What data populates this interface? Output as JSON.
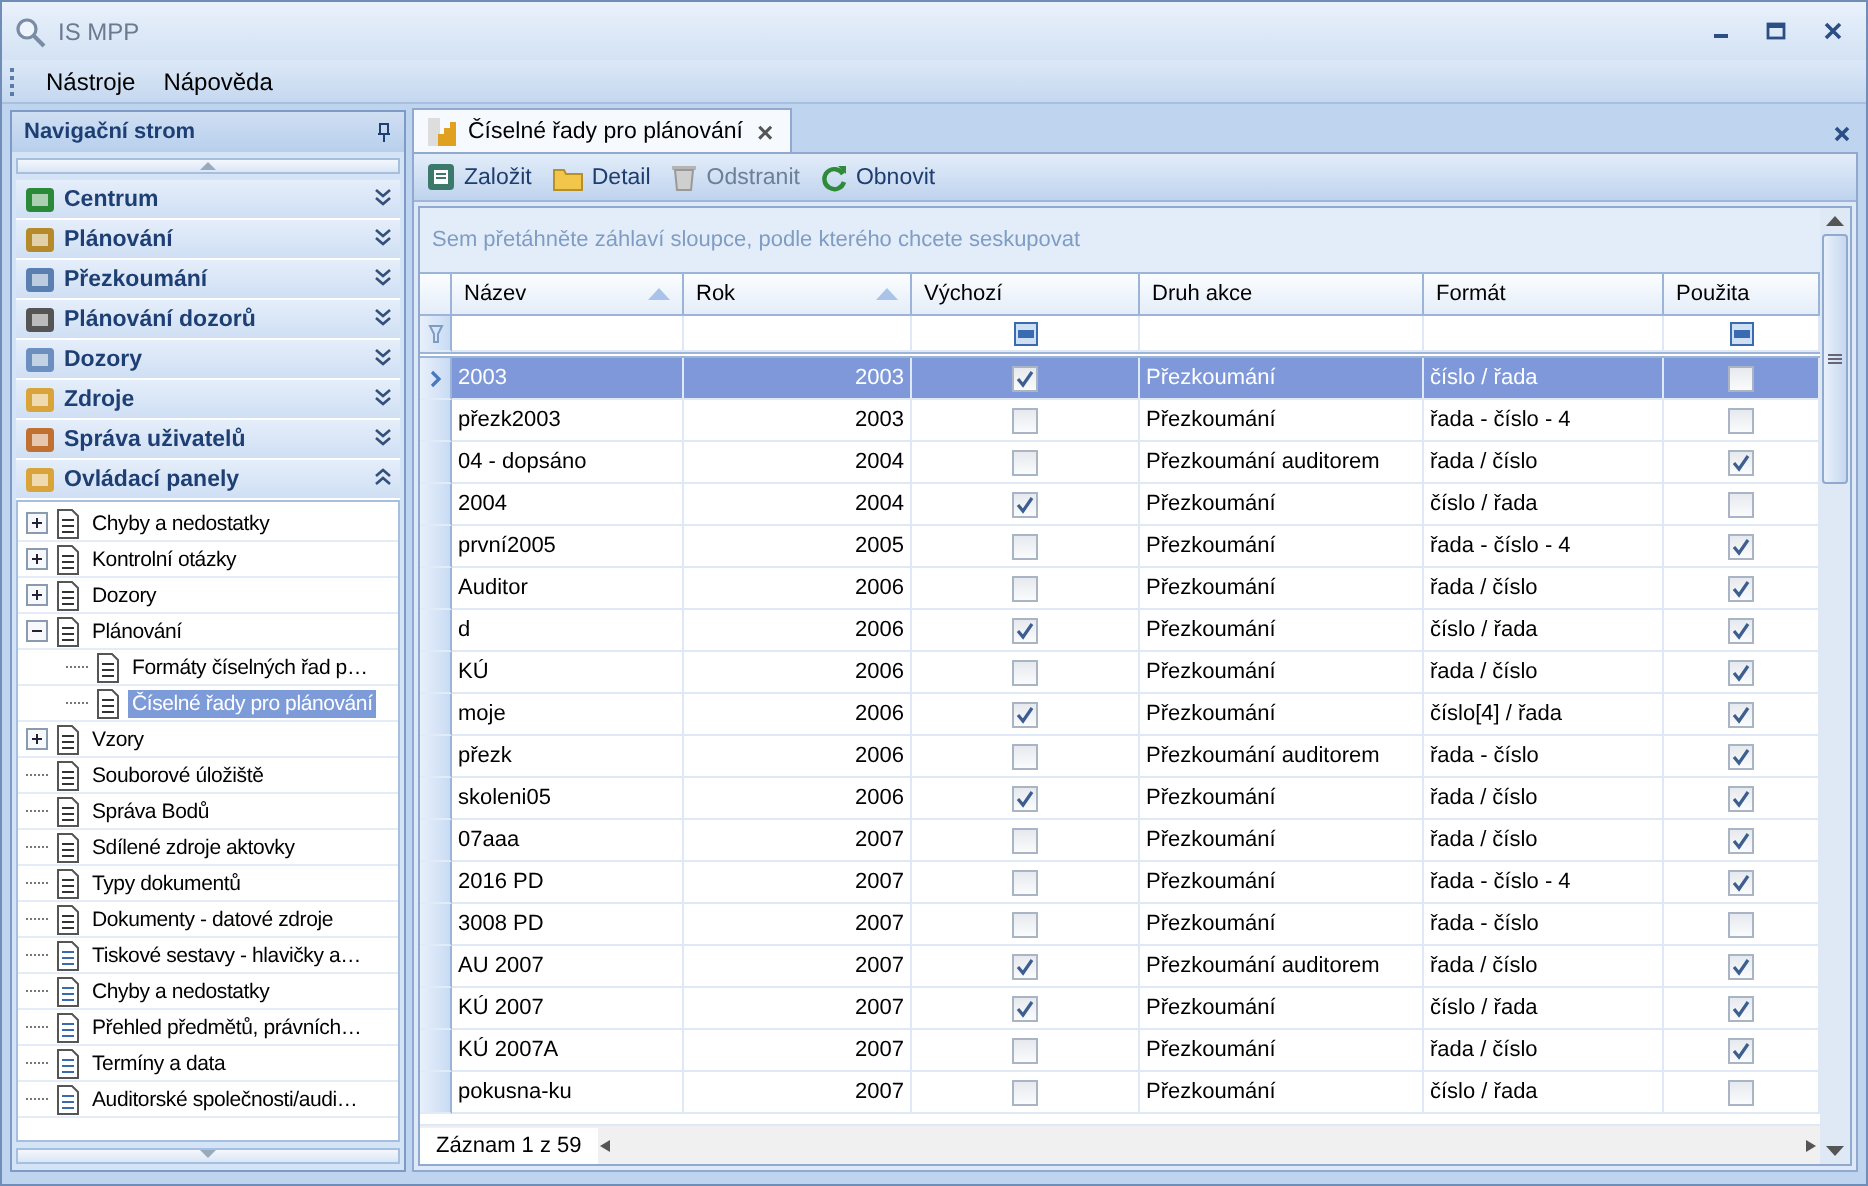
{
  "window": {
    "title": "IS MPP"
  },
  "menu": [
    "Nástroje",
    "Nápověda"
  ],
  "navigation": {
    "title": "Navigační strom",
    "groups": [
      {
        "label": "Centrum",
        "expanded": false
      },
      {
        "label": "Plánování",
        "expanded": false
      },
      {
        "label": "Přezkoumání",
        "expanded": false
      },
      {
        "label": "Plánování dozorů",
        "expanded": false
      },
      {
        "label": "Dozory",
        "expanded": false
      },
      {
        "label": "Zdroje",
        "expanded": false
      },
      {
        "label": "Správa uživatelů",
        "expanded": false
      },
      {
        "label": "Ovládací panely",
        "expanded": true
      }
    ],
    "tree": [
      {
        "label": "Chyby a nedostatky",
        "expanded": false,
        "selected": false
      },
      {
        "label": "Kontrolní otázky",
        "expanded": false,
        "selected": false
      },
      {
        "label": "Dozory",
        "expanded": false,
        "selected": false
      },
      {
        "label": "Plánování",
        "expanded": true,
        "selected": false,
        "children": [
          {
            "label": "Formáty číselných řad p…",
            "selected": false
          },
          {
            "label": "Číselné řady pro plánování",
            "selected": true
          }
        ]
      },
      {
        "label": "Vzory",
        "expanded": false,
        "selected": false
      },
      {
        "label": "Souborové úložiště",
        "selected": false
      },
      {
        "label": "Správa Bodů",
        "selected": false
      },
      {
        "label": "Sdílené zdroje aktovky",
        "selected": false
      },
      {
        "label": "Typy dokumentů",
        "selected": false
      },
      {
        "label": "Dokumenty - datové zdroje",
        "selected": false
      },
      {
        "label": "Tiskové sestavy - hlavičky a…",
        "selected": false
      },
      {
        "label": "Chyby a nedostatky",
        "selected": false
      },
      {
        "label": "Přehled předmětů, právních…",
        "selected": false
      },
      {
        "label": "Termíny a data",
        "selected": false
      },
      {
        "label": "Auditorské společnosti/audi…",
        "selected": false
      }
    ]
  },
  "document_tab": {
    "title": "Číselné řady pro plánování",
    "close": "×"
  },
  "toolbar": [
    {
      "label": "Založit",
      "disabled": false
    },
    {
      "label": "Detail",
      "disabled": false
    },
    {
      "label": "Odstranit",
      "disabled": true
    },
    {
      "label": "Obnovit",
      "disabled": false
    }
  ],
  "group_hint": "Sem přetáhněte záhlaví sloupce, podle kterého chcete seskupovat",
  "table": {
    "columns": [
      {
        "label": "Název",
        "sorted": true
      },
      {
        "label": "Rok",
        "sorted": true
      },
      {
        "label": "Výchozí",
        "sorted": false,
        "filter_indeterminate": true
      },
      {
        "label": "Druh akce",
        "sorted": false
      },
      {
        "label": "Formát",
        "sorted": false
      },
      {
        "label": "Použita",
        "sorted": false,
        "filter_indeterminate": true
      }
    ],
    "rows": [
      {
        "name": "2003",
        "year": "2003",
        "default": true,
        "action": "Přezkoumání",
        "format": "číslo / řada",
        "used": false,
        "selected": true
      },
      {
        "name": "přezk2003",
        "year": "2003",
        "default": false,
        "action": "Přezkoumání",
        "format": "řada - číslo - 4",
        "used": false,
        "selected": false
      },
      {
        "name": "04 - dopsáno",
        "year": "2004",
        "default": false,
        "action": "Přezkoumání auditorem",
        "format": "řada / číslo",
        "used": true,
        "selected": false
      },
      {
        "name": "2004",
        "year": "2004",
        "default": true,
        "action": "Přezkoumání",
        "format": "číslo / řada",
        "used": false,
        "selected": false
      },
      {
        "name": "první2005",
        "year": "2005",
        "default": false,
        "action": "Přezkoumání",
        "format": "řada - číslo - 4",
        "used": true,
        "selected": false
      },
      {
        "name": "Auditor",
        "year": "2006",
        "default": false,
        "action": "Přezkoumání",
        "format": "řada / číslo",
        "used": true,
        "selected": false
      },
      {
        "name": "d",
        "year": "2006",
        "default": true,
        "action": "Přezkoumání",
        "format": "číslo / řada",
        "used": true,
        "selected": false
      },
      {
        "name": "KÚ",
        "year": "2006",
        "default": false,
        "action": "Přezkoumání",
        "format": "řada / číslo",
        "used": true,
        "selected": false
      },
      {
        "name": "moje",
        "year": "2006",
        "default": true,
        "action": "Přezkoumání",
        "format": "číslo[4] / řada",
        "used": true,
        "selected": false
      },
      {
        "name": "přezk",
        "year": "2006",
        "default": false,
        "action": "Přezkoumání auditorem",
        "format": "řada - číslo",
        "used": true,
        "selected": false
      },
      {
        "name": "skoleni05",
        "year": "2006",
        "default": true,
        "action": "Přezkoumání",
        "format": "řada / číslo",
        "used": true,
        "selected": false
      },
      {
        "name": "07aaa",
        "year": "2007",
        "default": false,
        "action": "Přezkoumání",
        "format": "řada / číslo",
        "used": true,
        "selected": false
      },
      {
        "name": "2016 PD",
        "year": "2007",
        "default": false,
        "action": "Přezkoumání",
        "format": "řada - číslo - 4",
        "used": true,
        "selected": false
      },
      {
        "name": "3008 PD",
        "year": "2007",
        "default": false,
        "action": "Přezkoumání",
        "format": "řada - číslo",
        "used": false,
        "selected": false
      },
      {
        "name": "AU 2007",
        "year": "2007",
        "default": true,
        "action": "Přezkoumání auditorem",
        "format": "řada / číslo",
        "used": true,
        "selected": false
      },
      {
        "name": "KÚ 2007",
        "year": "2007",
        "default": true,
        "action": "Přezkoumání",
        "format": "číslo / řada",
        "used": true,
        "selected": false
      },
      {
        "name": "KÚ 2007A",
        "year": "2007",
        "default": false,
        "action": "Přezkoumání",
        "format": "řada / číslo",
        "used": true,
        "selected": false
      },
      {
        "name": "pokusna-ku",
        "year": "2007",
        "default": false,
        "action": "Přezkoumání",
        "format": "číslo / řada",
        "used": false,
        "selected": false
      }
    ]
  },
  "record_count": "Záznam 1 z 59"
}
